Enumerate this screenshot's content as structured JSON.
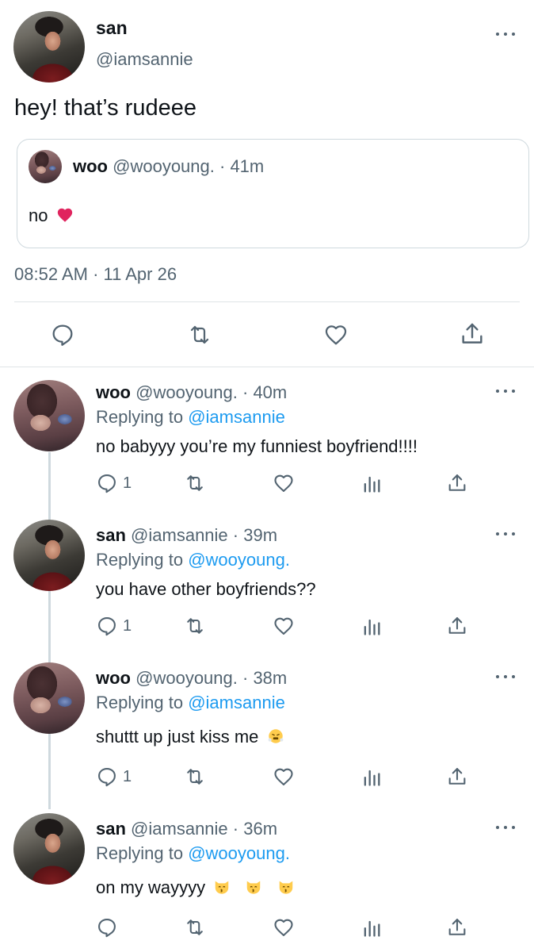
{
  "main_tweet": {
    "name": "san",
    "handle": "@iamsannie",
    "text": "hey! that’s rudeee",
    "timestamp": "08:52 AM · 11 Apr 26",
    "quote": {
      "name": "woo",
      "handle": "@wooyoung.",
      "time": "· 41m",
      "text": "no"
    }
  },
  "replies": [
    {
      "name": "woo",
      "handle": "@wooyoung.",
      "time": "· 40m",
      "replying_prefix": "Replying to",
      "replying_to": "@iamsannie",
      "text": "no babyyy you’re my funniest boyfriend!!!!",
      "reply_count": "1"
    },
    {
      "name": "san",
      "handle": "@iamsannie",
      "time": "· 39m",
      "replying_prefix": "Replying to",
      "replying_to": "@wooyoung.",
      "text": "you have other boyfriends??",
      "reply_count": "1"
    },
    {
      "name": "woo",
      "handle": "@wooyoung.",
      "time": "· 38m",
      "replying_prefix": "Replying to",
      "replying_to": "@iamsannie",
      "text": "shuttt up just kiss me",
      "reply_count": "1"
    },
    {
      "name": "san",
      "handle": "@iamsannie",
      "time": "· 36m",
      "replying_prefix": "Replying to",
      "replying_to": "@wooyoung.",
      "text": "on my wayyyy",
      "reply_count": ""
    }
  ],
  "colors": {
    "link": "#1d9bf0",
    "muted": "#536471",
    "text": "#0f1419",
    "border": "#cfd9de"
  },
  "icons": [
    "more-icon",
    "reply-icon",
    "retweet-icon",
    "like-icon",
    "share-icon",
    "analytics-icon",
    "heart-emoji",
    "steam-face-emoji",
    "kissing-cat-emoji"
  ]
}
